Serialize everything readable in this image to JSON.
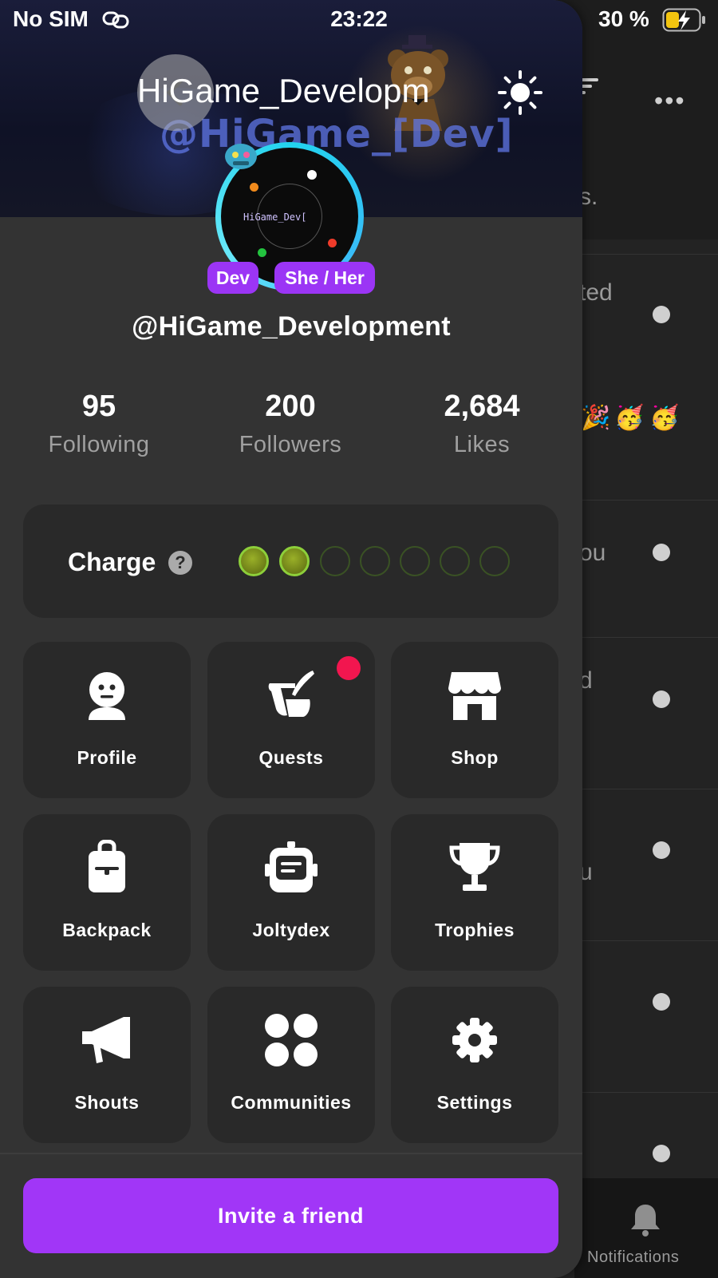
{
  "status_bar": {
    "carrier": "No SIM",
    "time": "23:22",
    "battery": "30 %"
  },
  "drawer": {
    "title": "HiGame_Developm",
    "banner_watermark": "@HiGame_[Dev]",
    "avatar_text": "HiGame_Dev[",
    "badges": [
      "Dev",
      "She / Her"
    ],
    "username": "@HiGame_Development",
    "stats": [
      {
        "value": "95",
        "label": "Following"
      },
      {
        "value": "200",
        "label": "Followers"
      },
      {
        "value": "2,684",
        "label": "Likes"
      }
    ],
    "charge": {
      "label": "Charge",
      "help": "?",
      "filled": 2,
      "total": 7
    },
    "tiles": [
      {
        "label": "Profile",
        "icon": "face-icon"
      },
      {
        "label": "Quests",
        "icon": "quill-scroll-icon",
        "has_notification": true
      },
      {
        "label": "Shop",
        "icon": "storefront-icon"
      },
      {
        "label": "Backpack",
        "icon": "backpack-icon"
      },
      {
        "label": "Joltydex",
        "icon": "robot-dex-icon"
      },
      {
        "label": "Trophies",
        "icon": "trophy-icon"
      },
      {
        "label": "Shouts",
        "icon": "megaphone-icon"
      },
      {
        "label": "Communities",
        "icon": "four-dots-icon"
      },
      {
        "label": "Settings",
        "icon": "gear-icon"
      }
    ],
    "invite_button": "Invite a friend"
  },
  "background_page": {
    "partial_texts": [
      "s.",
      "ted",
      "ou",
      "d",
      "u"
    ],
    "tab_label": "Notifications"
  },
  "colors": {
    "accent": "#a136f7",
    "badge": "#9b35f5",
    "notification": "#f2164f",
    "charge_on": "#8dcf3a",
    "drawer_bg": "#333333",
    "card_bg": "#292929"
  }
}
